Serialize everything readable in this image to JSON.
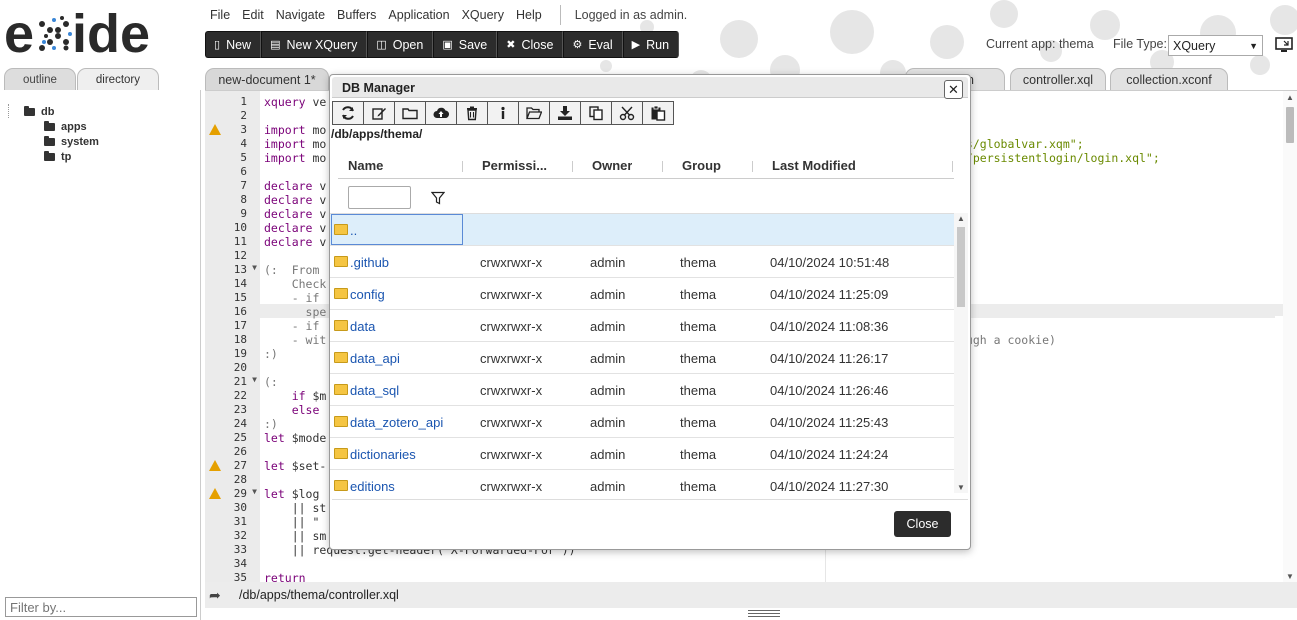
{
  "app": {
    "logo_text": "eXide",
    "menu": [
      "File",
      "Edit",
      "Navigate",
      "Buffers",
      "Application",
      "XQuery",
      "Help"
    ],
    "login_status": "Logged in as admin.",
    "toolbar": [
      {
        "label": "New",
        "icon": "file-icon"
      },
      {
        "label": "New XQuery",
        "icon": "file-code-icon"
      },
      {
        "label": "Open",
        "icon": "folder-open-icon"
      },
      {
        "label": "Save",
        "icon": "save-icon"
      },
      {
        "label": "Close",
        "icon": "close-icon"
      },
      {
        "label": "Eval",
        "icon": "gears-icon"
      },
      {
        "label": "Run",
        "icon": "play-icon"
      }
    ],
    "current_app": "Current app: thema",
    "file_type_label": "File Type:",
    "file_type_value": "XQuery",
    "accent_color": "#2c2c2c"
  },
  "sidebar": {
    "tabs": [
      "outline",
      "directory"
    ],
    "tree": {
      "root": "db",
      "children": [
        "apps",
        "system",
        "tp"
      ]
    },
    "filter_placeholder": "Filter by..."
  },
  "editor": {
    "tabs": [
      "new-document 1*",
      "n",
      "controller.xql",
      "collection.xconf"
    ],
    "lines": [
      {
        "n": "1",
        "text": "xquery ve"
      },
      {
        "n": "2",
        "text": ""
      },
      {
        "n": "3",
        "text": "import mo",
        "warn": true
      },
      {
        "n": "4",
        "text": "import mo"
      },
      {
        "n": "5",
        "text": "import mo"
      },
      {
        "n": "6",
        "text": ""
      },
      {
        "n": "7",
        "text": "declare v"
      },
      {
        "n": "8",
        "text": "declare v"
      },
      {
        "n": "9",
        "text": "declare v"
      },
      {
        "n": "10",
        "text": "declare v"
      },
      {
        "n": "11",
        "text": "declare v"
      },
      {
        "n": "12",
        "text": ""
      },
      {
        "n": "13",
        "text": "(:  From",
        "fold": true
      },
      {
        "n": "14",
        "text": "    Check"
      },
      {
        "n": "15",
        "text": "    - if"
      },
      {
        "n": "16",
        "text": "      spe"
      },
      {
        "n": "17",
        "text": "    - if"
      },
      {
        "n": "18",
        "text": "    - wit"
      },
      {
        "n": "19",
        "text": ":)"
      },
      {
        "n": "20",
        "text": ""
      },
      {
        "n": "21",
        "text": "(:",
        "fold": true
      },
      {
        "n": "22",
        "text": "    if $m"
      },
      {
        "n": "23",
        "text": "    else"
      },
      {
        "n": "24",
        "text": ":)"
      },
      {
        "n": "25",
        "text": "let $mode"
      },
      {
        "n": "26",
        "text": ""
      },
      {
        "n": "27",
        "text": "let $set-",
        "warn": true
      },
      {
        "n": "28",
        "text": ""
      },
      {
        "n": "29",
        "text": "let $log",
        "warn": true,
        "fold": true
      },
      {
        "n": "30",
        "text": "    || st"
      },
      {
        "n": "31",
        "text": "    || \""
      },
      {
        "n": "32",
        "text": "    || sm"
      },
      {
        "n": "33",
        "text": "    || request:get-header(\"X-Forwarded-For\"))"
      },
      {
        "n": "34",
        "text": ""
      },
      {
        "n": "35",
        "text": "return"
      }
    ],
    "right_lines": [
      {
        "line": 4,
        "text": "es/globalvar.xqm\";"
      },
      {
        "line": 5,
        "text": "s/persistentlogin/login.xql\";"
      },
      {
        "line": 18,
        "text": "ough a cookie)"
      }
    ],
    "status_path": "/db/apps/thema/controller.xql"
  },
  "dialog": {
    "title": "DB Manager",
    "close_x": "✕",
    "tools": [
      "refresh-icon",
      "edit-icon",
      "new-folder-icon",
      "upload-icon",
      "trash-icon",
      "info-icon",
      "open-icon",
      "download-icon",
      "copy-icon",
      "cut-icon",
      "paste-icon"
    ],
    "path": "/db/apps/thema/",
    "columns": [
      "Name",
      "Permissi...",
      "Owner",
      "Group",
      "Last Modified"
    ],
    "rows": [
      {
        "name": "..",
        "perm": "",
        "owner": "",
        "group": "",
        "modified": "",
        "selected": true
      },
      {
        "name": ".github",
        "perm": "crwxrwxr-x",
        "owner": "admin",
        "group": "thema",
        "modified": "04/10/2024 10:51:48"
      },
      {
        "name": "config",
        "perm": "crwxrwxr-x",
        "owner": "admin",
        "group": "thema",
        "modified": "04/10/2024 11:25:09"
      },
      {
        "name": "data",
        "perm": "crwxrwxr-x",
        "owner": "admin",
        "group": "thema",
        "modified": "04/10/2024 11:08:36"
      },
      {
        "name": "data_api",
        "perm": "crwxrwxr-x",
        "owner": "admin",
        "group": "thema",
        "modified": "04/10/2024 11:26:17"
      },
      {
        "name": "data_sql",
        "perm": "crwxrwxr-x",
        "owner": "admin",
        "group": "thema",
        "modified": "04/10/2024 11:26:46"
      },
      {
        "name": "data_zotero_api",
        "perm": "crwxrwxr-x",
        "owner": "admin",
        "group": "thema",
        "modified": "04/10/2024 11:25:43"
      },
      {
        "name": "dictionaries",
        "perm": "crwxrwxr-x",
        "owner": "admin",
        "group": "thema",
        "modified": "04/10/2024 11:24:24"
      },
      {
        "name": "editions",
        "perm": "crwxrwxr-x",
        "owner": "admin",
        "group": "thema",
        "modified": "04/10/2024 11:27:30"
      }
    ],
    "close_button": "Close"
  }
}
